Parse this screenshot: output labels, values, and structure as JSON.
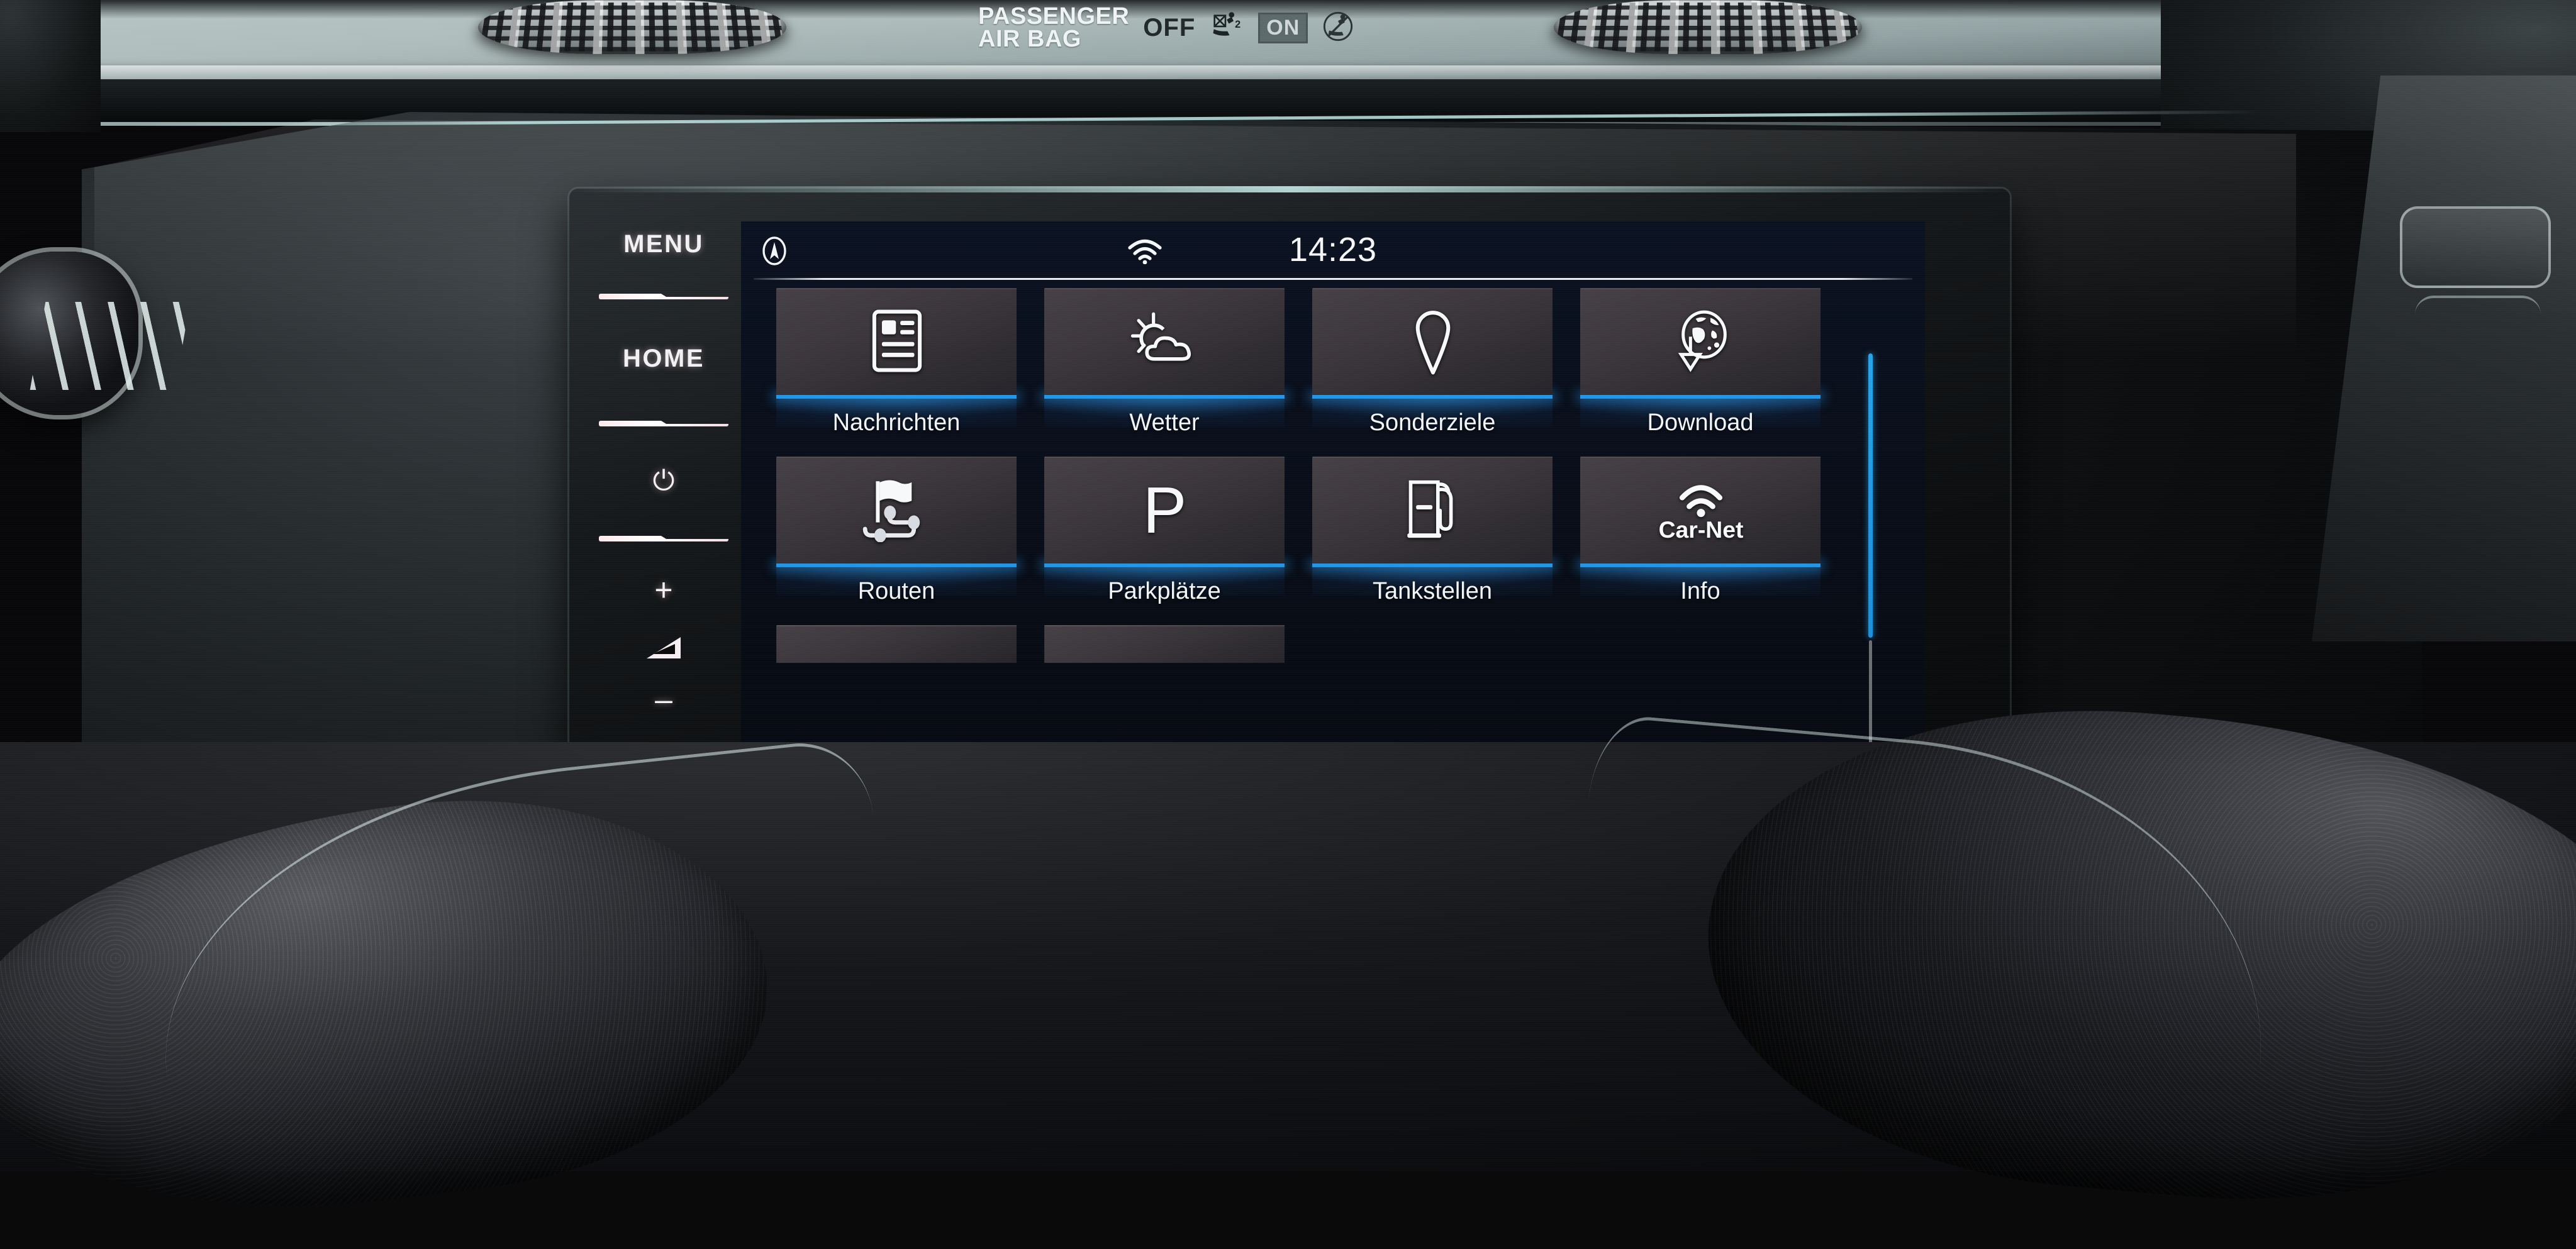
{
  "vehicle": {
    "airbag": {
      "title_line1": "PASSENGER",
      "title_line2": "AIR BAG",
      "off_label": "OFF",
      "on_label": "ON",
      "off_icon": "airbag-child-seat-icon",
      "on_icon": "airbag-no-child-seat-icon"
    },
    "hardware_keys": [
      {
        "label": "MENU",
        "name": "menu-hard-key",
        "type": "text"
      },
      {
        "label": "HOME",
        "name": "home-hard-key",
        "type": "text"
      },
      {
        "label": "⏻",
        "name": "power-hard-key",
        "type": "icon"
      },
      {
        "label": "+",
        "name": "volume-up-hard-key",
        "type": "icon"
      },
      {
        "label": "",
        "name": "volume-indicator-icon",
        "type": "triangle"
      },
      {
        "label": "–",
        "name": "volume-down-hard-key",
        "type": "icon"
      }
    ]
  },
  "screen": {
    "statusbar": {
      "nav_icon": "navigation-arrow-icon",
      "wifi_icon": "wifi-icon",
      "clock": "14:23"
    },
    "tiles": [
      {
        "label": "Nachrichten",
        "icon": "news-article-icon",
        "name": "tile-nachrichten"
      },
      {
        "label": "Wetter",
        "icon": "sun-cloud-weather-icon",
        "name": "tile-wetter"
      },
      {
        "label": "Sonderziele",
        "icon": "map-pin-icon",
        "name": "tile-sonderziele"
      },
      {
        "label": "Download",
        "icon": "globe-download-icon",
        "name": "tile-download"
      },
      {
        "label": "Routen",
        "icon": "flag-route-waypoints-icon",
        "name": "tile-routen"
      },
      {
        "label": "Parkplätze",
        "icon": "parking-p-icon",
        "name": "tile-parkplaetze"
      },
      {
        "label": "Tankstellen",
        "icon": "fuel-pump-icon",
        "name": "tile-tankstellen"
      },
      {
        "label": "Info",
        "icon": "car-net-wifi-icon",
        "name": "tile-info"
      }
    ],
    "partial_tiles": [
      {
        "label": "",
        "name": "tile-partial-1"
      },
      {
        "label": "",
        "name": "tile-partial-2"
      }
    ],
    "bottombar": {
      "settings_icon": "settings-gears-icon"
    },
    "scrollbar": {
      "thumb_position_pct": 0,
      "thumb_size_pct": 67
    },
    "colors": {
      "accent_blue": "#2196e8",
      "screen_bg": "#080d18",
      "tile_face": "#3b363b",
      "text": "#f2f5f8"
    }
  }
}
